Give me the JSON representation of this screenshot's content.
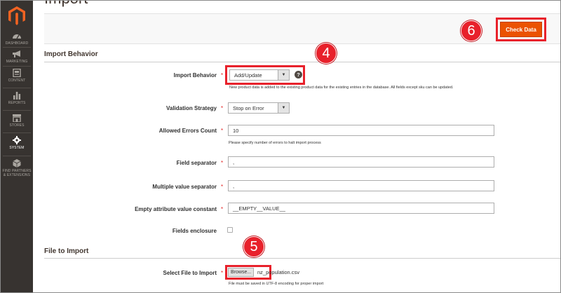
{
  "sidebar": {
    "logo": "magento-logo-icon",
    "items": [
      {
        "label": "DASHBOARD",
        "icon": "dashboard-icon"
      },
      {
        "label": "MARKETING",
        "icon": "megaphone-icon"
      },
      {
        "label": "CONTENT",
        "icon": "content-icon"
      },
      {
        "label": "REPORTS",
        "icon": "bar-chart-icon"
      },
      {
        "label": "STORES",
        "icon": "store-icon"
      },
      {
        "label": "SYSTEM",
        "icon": "gear-icon"
      },
      {
        "label": "FIND PARTNERS",
        "label2": "& EXTENSIONS",
        "icon": "cube-icon"
      }
    ],
    "active": "SYSTEM"
  },
  "page": {
    "title": "Import",
    "check_data_label": "Check Data"
  },
  "import_behavior": {
    "section_title": "Import Behavior",
    "behavior_label": "Import Behavior",
    "behavior_value": "Add/Update",
    "behavior_note": "New product data is added to the existing product data for the existing entries in the database. All fields except sku can be updated.",
    "validation_label": "Validation Strategy",
    "validation_value": "Stop on Error",
    "errors_label": "Allowed Errors Count",
    "errors_value": "10",
    "errors_note": "Please specify number of errors to halt import process",
    "field_sep_label": "Field separator",
    "field_sep_value": ",",
    "multi_sep_label": "Multiple value separator",
    "multi_sep_value": ",",
    "empty_attr_label": "Empty attribute value constant",
    "empty_attr_value": "__EMPTY__VALUE__",
    "enclosure_label": "Fields enclosure"
  },
  "file_to_import": {
    "section_title": "File to Import",
    "select_label": "Select File to Import",
    "browse_label": "Browse...",
    "file_name": "nz_population.csv",
    "file_note": "File must be saved in UTF-8 encoding for proper import"
  },
  "annotations": {
    "badge_4": "4",
    "badge_5": "5",
    "badge_6": "6",
    "highlight_color": "#e8212b"
  },
  "colors": {
    "accent": "#eb5202",
    "sidebar_bg": "#373330"
  }
}
